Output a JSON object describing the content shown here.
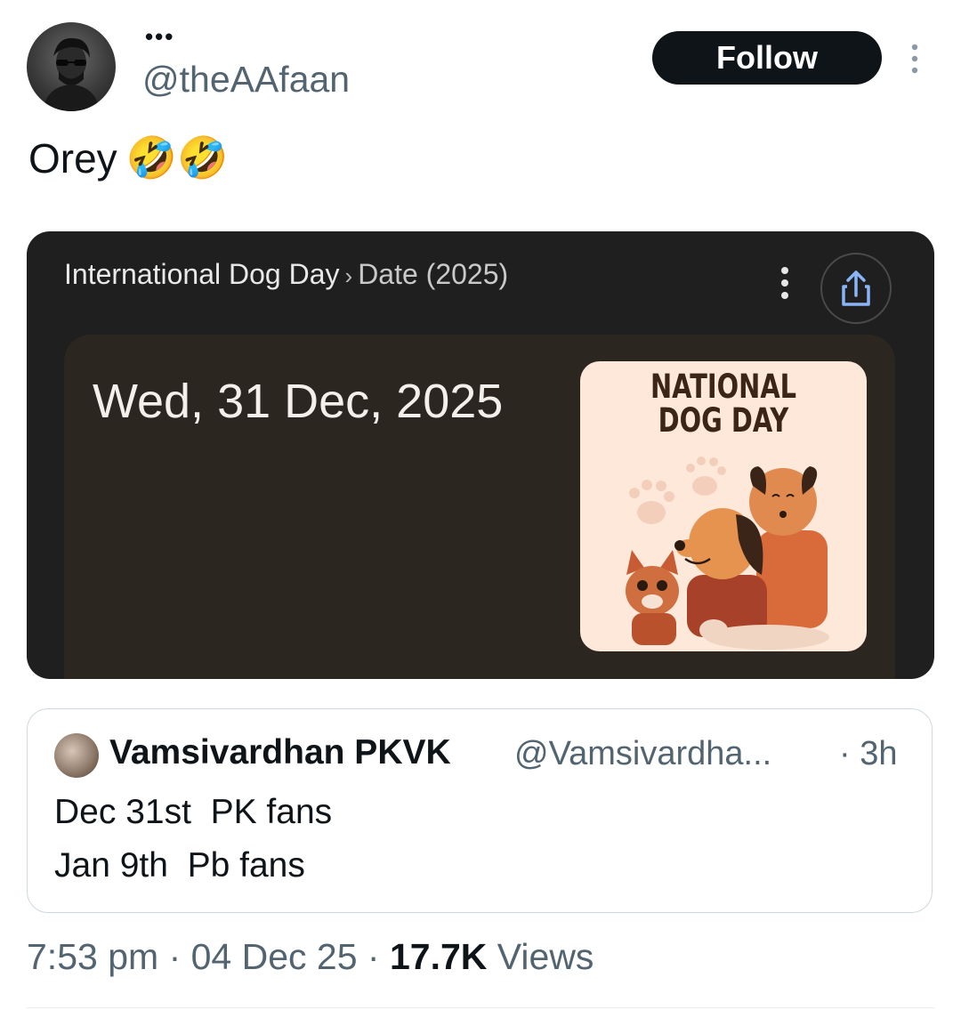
{
  "header": {
    "display_name": "•••",
    "handle": "@theAAfaan",
    "follow_label": "Follow"
  },
  "tweet": {
    "text": "Orey",
    "emojis": "🤣🤣"
  },
  "media": {
    "breadcrumb_main": "International Dog Day",
    "breadcrumb_sep": "›",
    "breadcrumb_sub": "Date (2025)",
    "date_value": "Wed, 31 Dec, 2025",
    "image_title_line1": "NATIONAL",
    "image_title_line2": "DOG DAY",
    "colors": {
      "card_bg": "#1f1f1f",
      "inner_bg": "#2c2621",
      "image_bg": "#fde8da"
    }
  },
  "quote": {
    "author_name": "Vamsivardhan PKVK",
    "author_handle": "@Vamsivardha...",
    "time": "· 3h",
    "lines": [
      "Dec 31st  PK fans",
      "Jan 9th  Pb fans"
    ]
  },
  "footer": {
    "time": "7:53 pm",
    "date": "04 Dec 25",
    "views_count": "17.7K",
    "views_label": "Views"
  }
}
